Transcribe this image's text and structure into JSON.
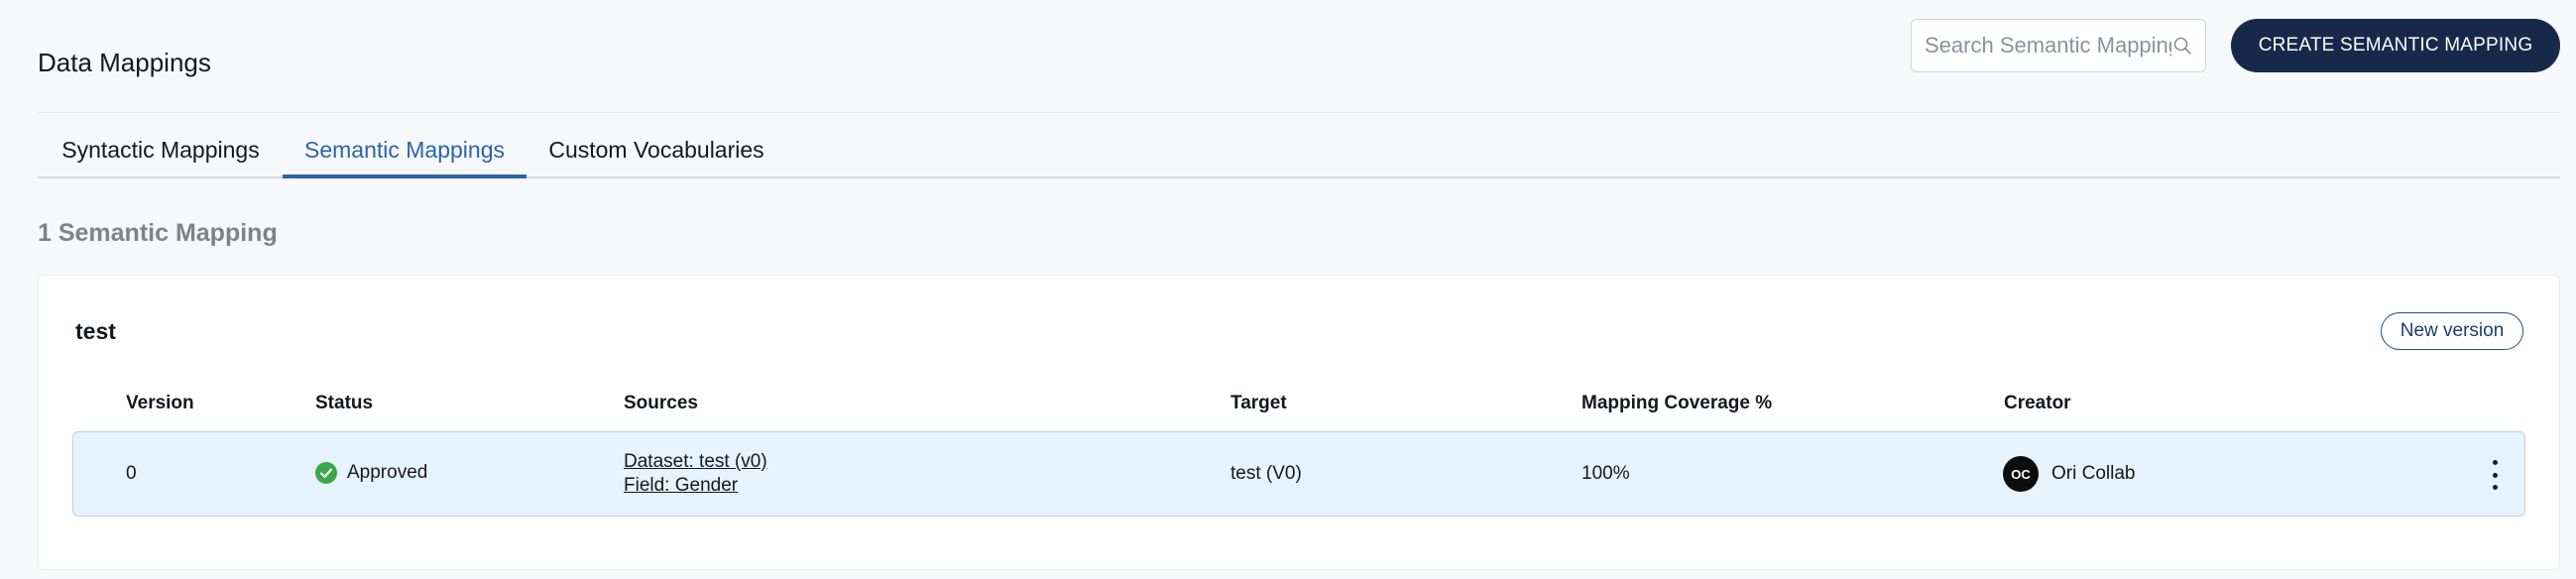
{
  "header": {
    "title": "Data Mappings",
    "search_placeholder": "Search Semantic Mappings",
    "create_label": "CREATE SEMANTIC MAPPING"
  },
  "tabs": [
    {
      "label": "Syntactic Mappings",
      "active": false
    },
    {
      "label": "Semantic Mappings",
      "active": true
    },
    {
      "label": "Custom Vocabularies",
      "active": false
    }
  ],
  "count_heading": "1 Semantic Mapping",
  "card": {
    "title": "test",
    "new_version_label": "New version",
    "columns": [
      "Version",
      "Status",
      "Sources",
      "Target",
      "Mapping Coverage %",
      "Creator"
    ],
    "rows": [
      {
        "version": "0",
        "status": "Approved",
        "sources": [
          "Dataset: test (v0)",
          "Field: Gender"
        ],
        "target": "test (V0)",
        "coverage": "100%",
        "creator_initials": "OC",
        "creator_name": "Ori Collab"
      }
    ]
  },
  "icons": {
    "search": "search-icon",
    "status_approved": "check-circle-icon",
    "row_menu": "more-vertical-icon"
  },
  "colors": {
    "primary": "#17294a",
    "active_tab": "#2d63a8",
    "approved": "#3aa84a",
    "row_highlight": "#e6f2fc"
  }
}
